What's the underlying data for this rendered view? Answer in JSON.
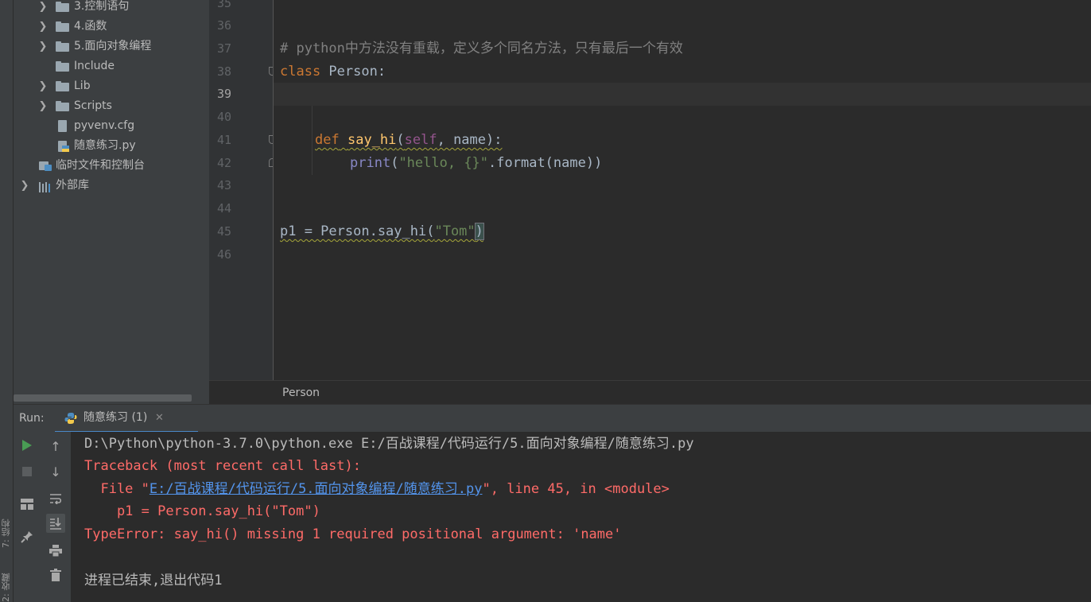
{
  "side_strip": {
    "label_top": "7: 结构",
    "label_bottom": "2: 收藏"
  },
  "project_tree": [
    {
      "label": "3.控制语句",
      "type": "folder",
      "expandable": true
    },
    {
      "label": "4.函数",
      "type": "folder",
      "expandable": true
    },
    {
      "label": "5.面向对象编程",
      "type": "folder",
      "expandable": true
    },
    {
      "label": "Include",
      "type": "folder",
      "expandable": false
    },
    {
      "label": "Lib",
      "type": "folder",
      "expandable": true
    },
    {
      "label": "Scripts",
      "type": "folder",
      "expandable": true
    },
    {
      "label": "pyvenv.cfg",
      "type": "file",
      "expandable": false
    },
    {
      "label": "随意练习.py",
      "type": "python-file",
      "expandable": false
    },
    {
      "label": "临时文件和控制台",
      "type": "scratches",
      "expandable": false
    },
    {
      "label": "外部库",
      "type": "libraries",
      "expandable": true
    }
  ],
  "editor": {
    "line_numbers": [
      "35",
      "36",
      "37",
      "38",
      "39",
      "40",
      "41",
      "42",
      "43",
      "44",
      "45",
      "46"
    ],
    "current_line": "39",
    "code": {
      "l37_comment": "# python中方法没有重载，定义多个同名方法，只有最后一个有效",
      "l38_kw": "class",
      "l38_name": " Person:",
      "l41_kw": "def",
      "l41_fn": "say_hi",
      "l41_open": "(",
      "l41_self": "self",
      "l41_rest": ", name):",
      "l42_builtin": "print",
      "l42_open": "(",
      "l42_str": "\"hello, {}\"",
      "l42_rest": ".format(name))",
      "l45_code": "p1 = Person.say_hi(",
      "l45_str": "\"Tom\"",
      "l45_close": ")"
    },
    "breadcrumb": "Person"
  },
  "run_panel": {
    "label": "Run:",
    "tab_label": "随意练习 (1)",
    "output": {
      "command": "D:\\Python\\python-3.7.0\\python.exe E:/百战课程/代码运行/5.面向对象编程/随意练习.py",
      "traceback": "Traceback (most recent call last):",
      "file_prefix": "  File \"",
      "file_link": "E:/百战课程/代码运行/5.面向对象编程/随意练习.py",
      "file_suffix": "\", line 45, in <module>",
      "code_line": "    p1 = Person.say_hi(\"Tom\")",
      "error": "TypeError: say_hi() missing 1 required positional argument: 'name'",
      "exit": "进程已结束,退出代码1"
    }
  },
  "colors": {
    "keyword": "#cc7832",
    "function": "#ffc66d",
    "string": "#6a8759",
    "error": "#ff6b68",
    "link": "#5394ec",
    "run_green": "#499c54"
  }
}
